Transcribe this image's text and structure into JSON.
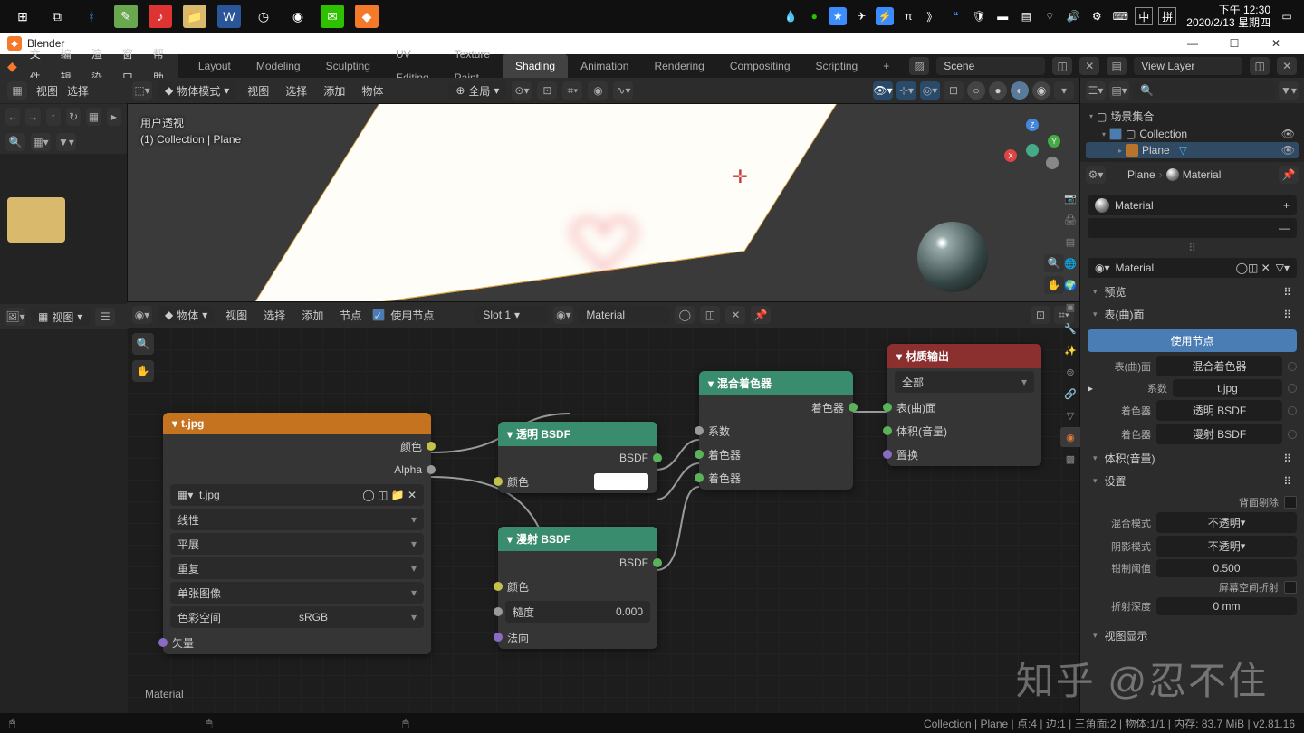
{
  "taskbar": {
    "clock_time": "下午 12:30",
    "clock_date": "2020/2/13 星期四",
    "ime1": "中",
    "ime2": "拼"
  },
  "titlebar": {
    "app": "Blender"
  },
  "menubar": {
    "file": "文件",
    "edit": "编辑",
    "render": "渲染",
    "window": "窗口",
    "help": "帮助",
    "tabs": [
      "Layout",
      "Modeling",
      "Sculpting",
      "UV Editing",
      "Texture Paint",
      "Shading",
      "Animation",
      "Rendering",
      "Compositing",
      "Scripting"
    ],
    "active_tab": 5,
    "scene": "Scene",
    "view_layer": "View Layer"
  },
  "left_header": {
    "view": "视图",
    "select": "选择"
  },
  "vp_header": {
    "mode": "物体模式",
    "view": "视图",
    "select": "选择",
    "add": "添加",
    "object": "物体",
    "global": "全局"
  },
  "vp_info": {
    "l1": "用户透视",
    "l2": "(1) Collection | Plane"
  },
  "ne_header": {
    "mode": "物体",
    "view": "视图",
    "select": "选择",
    "add": "添加",
    "node": "节点",
    "use_nodes": "使用节点",
    "slot": "Slot 1",
    "material": "Material"
  },
  "img_editor": {
    "view": "视图"
  },
  "nodes": {
    "img": {
      "title": "t.jpg",
      "out_color": "颜色",
      "out_alpha": "Alpha",
      "file": "t.jpg",
      "interp": "线性",
      "proj": "平展",
      "ext": "重复",
      "src": "单张图像",
      "cs_label": "色彩空间",
      "cs": "sRGB",
      "vector": "矢量"
    },
    "transp": {
      "title": "透明 BSDF",
      "out": "BSDF",
      "color": "颜色"
    },
    "diffuse": {
      "title": "漫射 BSDF",
      "out": "BSDF",
      "color": "颜色",
      "rough": "糙度",
      "rough_val": "0.000",
      "normal": "法向"
    },
    "mix": {
      "title": "混合着色器",
      "out": "着色器",
      "fac": "系数",
      "in1": "着色器",
      "in2": "着色器"
    },
    "output": {
      "title": "材质输出",
      "target": "全部",
      "surface": "表(曲)面",
      "volume": "体积(音量)",
      "disp": "置换"
    }
  },
  "outliner": {
    "scene_coll": "场景集合",
    "collection": "Collection",
    "plane": "Plane"
  },
  "props": {
    "plane_label": "Plane",
    "mat_label": "Material",
    "mat_name": "Material",
    "preview": "预览",
    "surface_sec": "表(曲)面",
    "use_nodes_btn": "使用节点",
    "surface": {
      "label": "表(曲)面",
      "val": "混合着色器"
    },
    "fac": {
      "label": "系数",
      "val": "t.jpg"
    },
    "sh1": {
      "label": "着色器",
      "val": "透明 BSDF"
    },
    "sh2": {
      "label": "着色器",
      "val": "漫射 BSDF"
    },
    "volume_sec": "体积(音量)",
    "settings_sec": "设置",
    "backface": "背面剔除",
    "blend": {
      "label": "混合模式",
      "val": "不透明"
    },
    "shadow": {
      "label": "阴影模式",
      "val": "不透明"
    },
    "clip": {
      "label": "钳制阈值",
      "val": "0.500"
    },
    "ssr": "屏幕空间折射",
    "refr": {
      "label": "折射深度",
      "val": "0 mm"
    },
    "vp_disp": "视图显示"
  },
  "status": {
    "breadcrumb": "Collection | Plane | 点:4 | 边:1 | 三角面:2 | 物体:1/1 | 内存: 83.7 MiB | v2.81.16"
  },
  "material_corner": "Material",
  "watermark": "知乎 @忍不住"
}
